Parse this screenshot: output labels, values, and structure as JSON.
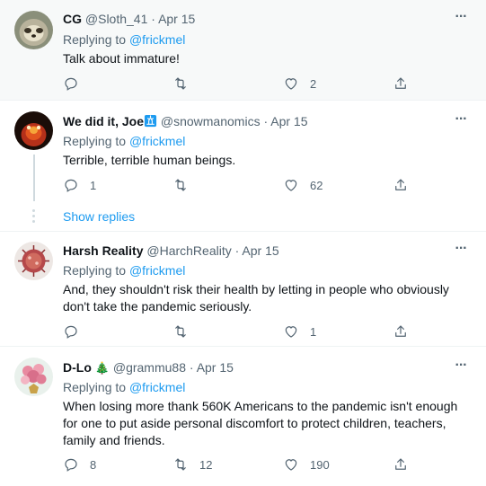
{
  "tweets": [
    {
      "name": "CG",
      "handle": "@Sloth_41",
      "dot": "·",
      "date": "Apr 15",
      "replying_prefix": "Replying to",
      "replying_to": "@frickmel",
      "text": "Talk about immature!",
      "reply_count": "",
      "retweet_count": "",
      "like_count": "2"
    },
    {
      "name": "We did it, Joe",
      "handle": "@snowmanomics",
      "dot": "·",
      "date": "Apr 15",
      "replying_prefix": "Replying to",
      "replying_to": "@frickmel",
      "text": "Terrible, terrible human beings.",
      "reply_count": "1",
      "retweet_count": "",
      "like_count": "62",
      "show_replies": "Show replies"
    },
    {
      "name": "Harsh Reality",
      "handle": "@HarchReality",
      "dot": "·",
      "date": "Apr 15",
      "replying_prefix": "Replying to",
      "replying_to": "@frickmel",
      "text": "And, they shouldn't risk their health by letting in people who obviously don't take the pandemic seriously.",
      "reply_count": "",
      "retweet_count": "",
      "like_count": "1"
    },
    {
      "name": "D-Lo",
      "name_emoji": "🎄",
      "handle": "@grammu88",
      "dot": "·",
      "date": "Apr 15",
      "replying_prefix": "Replying to",
      "replying_to": "@frickmel",
      "text": "When losing more thank 560K Americans to the pandemic isn't enough for one to put aside personal discomfort to protect children, teachers, family and friends.",
      "reply_count": "8",
      "retweet_count": "12",
      "like_count": "190"
    }
  ],
  "icons": {
    "reply": "reply-icon",
    "retweet": "retweet-icon",
    "like": "like-icon",
    "share": "share-icon",
    "more": "more-icon"
  },
  "colors": {
    "link": "#1d9bf0",
    "muted": "#536471",
    "shaded_bg": "#f7f9f9"
  }
}
